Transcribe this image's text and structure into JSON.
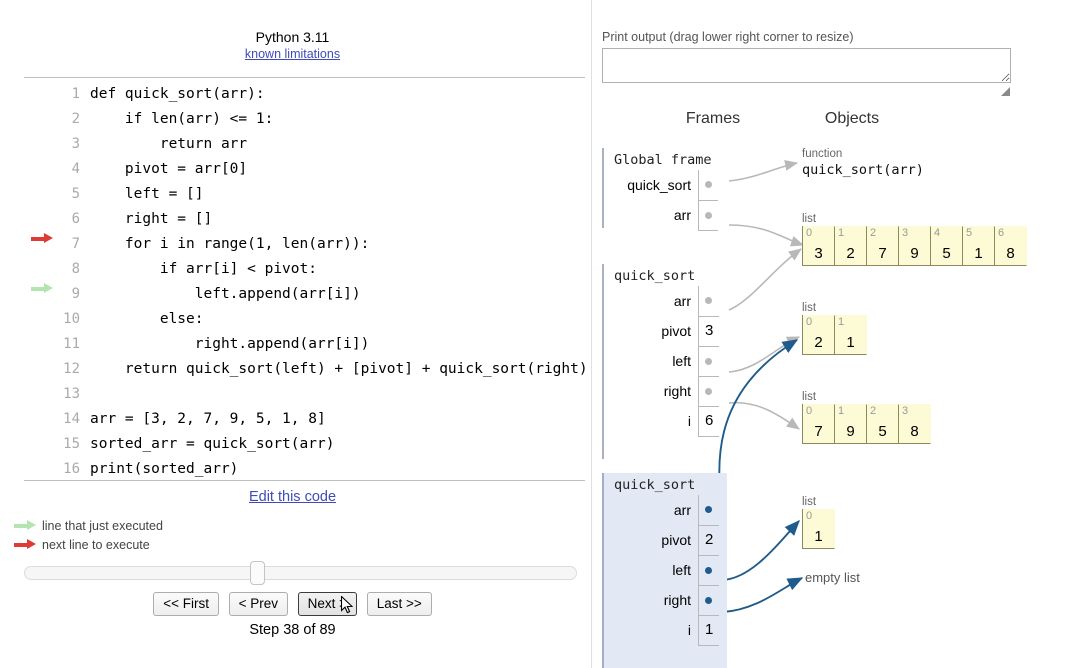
{
  "left": {
    "lang_title": "Python 3.11",
    "known_limitations_link": "known limitations",
    "edit_link": "Edit this code",
    "code_lines": [
      {
        "n": "1",
        "text": "def quick_sort(arr):",
        "arrow": ""
      },
      {
        "n": "2",
        "text": "    if len(arr) <= 1:",
        "arrow": ""
      },
      {
        "n": "3",
        "text": "        return arr",
        "arrow": ""
      },
      {
        "n": "4",
        "text": "    pivot = arr[0]",
        "arrow": ""
      },
      {
        "n": "5",
        "text": "    left = []",
        "arrow": ""
      },
      {
        "n": "6",
        "text": "    right = []",
        "arrow": ""
      },
      {
        "n": "7",
        "text": "    for i in range(1, len(arr)):",
        "arrow": "red"
      },
      {
        "n": "8",
        "text": "        if arr[i] < pivot:",
        "arrow": ""
      },
      {
        "n": "9",
        "text": "            left.append(arr[i])",
        "arrow": "green"
      },
      {
        "n": "10",
        "text": "        else:",
        "arrow": ""
      },
      {
        "n": "11",
        "text": "            right.append(arr[i])",
        "arrow": ""
      },
      {
        "n": "12",
        "text": "    return quick_sort(left) + [pivot] + quick_sort(right)",
        "arrow": ""
      },
      {
        "n": "13",
        "text": "",
        "arrow": ""
      },
      {
        "n": "14",
        "text": "arr = [3, 2, 7, 9, 5, 1, 8]",
        "arrow": ""
      },
      {
        "n": "15",
        "text": "sorted_arr = quick_sort(arr)",
        "arrow": ""
      },
      {
        "n": "16",
        "text": "print(sorted_arr)",
        "arrow": ""
      }
    ],
    "legend": [
      {
        "arrow": "green",
        "label": "line that just executed"
      },
      {
        "arrow": "red",
        "label": "next line to execute"
      }
    ],
    "buttons": {
      "first": "<< First",
      "prev": "< Prev",
      "next": "Next >",
      "last": "Last >>"
    },
    "step_label": "Step 38 of 89",
    "slider_value_percent": 42
  },
  "right": {
    "print_output_label": "Print output (drag lower right corner to resize)",
    "print_output_value": "",
    "frames_heading": "Frames",
    "objects_heading": "Objects",
    "frames": [
      {
        "name": "Global frame",
        "highlighted": false,
        "vars": [
          {
            "name": "quick_sort",
            "kind": "pointer",
            "value": ""
          },
          {
            "name": "arr",
            "kind": "pointer",
            "value": ""
          }
        ]
      },
      {
        "name": "quick_sort",
        "highlighted": false,
        "vars": [
          {
            "name": "arr",
            "kind": "pointer",
            "value": ""
          },
          {
            "name": "pivot",
            "kind": "value",
            "value": "3"
          },
          {
            "name": "left",
            "kind": "pointer",
            "value": ""
          },
          {
            "name": "right",
            "kind": "pointer",
            "value": ""
          },
          {
            "name": "i",
            "kind": "value",
            "value": "6"
          }
        ]
      },
      {
        "name": "quick_sort",
        "highlighted": true,
        "vars": [
          {
            "name": "arr",
            "kind": "pointer",
            "value": ""
          },
          {
            "name": "pivot",
            "kind": "value",
            "value": "2"
          },
          {
            "name": "left",
            "kind": "pointer",
            "value": ""
          },
          {
            "name": "right",
            "kind": "pointer",
            "value": ""
          },
          {
            "name": "i",
            "kind": "value",
            "value": "1"
          }
        ]
      }
    ],
    "objects": [
      {
        "type_label": "function",
        "kind": "function",
        "signature": "quick_sort(arr)"
      },
      {
        "type_label": "list",
        "kind": "list",
        "indices": [
          "0",
          "1",
          "2",
          "3",
          "4",
          "5",
          "6"
        ],
        "values": [
          "3",
          "2",
          "7",
          "9",
          "5",
          "1",
          "8"
        ]
      },
      {
        "type_label": "list",
        "kind": "list",
        "indices": [
          "0",
          "1"
        ],
        "values": [
          "2",
          "1"
        ]
      },
      {
        "type_label": "list",
        "kind": "list",
        "indices": [
          "0",
          "1",
          "2",
          "3"
        ],
        "values": [
          "7",
          "9",
          "5",
          "8"
        ]
      },
      {
        "type_label": "list",
        "kind": "list",
        "indices": [
          "0"
        ],
        "values": [
          "1"
        ]
      },
      {
        "type_label": "",
        "kind": "empty",
        "empty_label": "empty list"
      }
    ]
  },
  "colors": {
    "next_line_arrow": "#e03a34",
    "executed_line_arrow": "#b3e5b3",
    "heap_list_fill": "#fdfbd5",
    "heap_list_border": "#8a8a5a",
    "highlighted_frame_bg": "#e2e9f5",
    "active_pointer": "#1f5c8b",
    "link": "#3d4cb8"
  }
}
